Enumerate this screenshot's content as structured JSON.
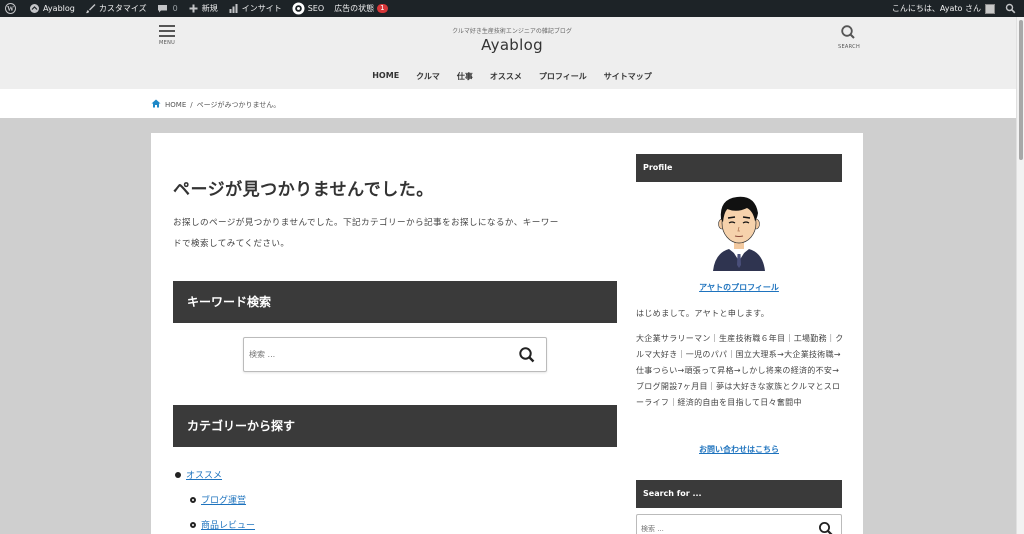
{
  "admin_bar": {
    "site_name": "Ayablog",
    "customize": "カスタマイズ",
    "comments_count": "0",
    "new": "新規",
    "insight": "インサイト",
    "seo": "SEO",
    "ad_status": "広告の状態",
    "ad_badge": "1",
    "greeting": "こんにちは、Ayato さん"
  },
  "header": {
    "menu_label": "MENU",
    "search_label": "SEARCH",
    "tagline": "クルマ好き生産技術エンジニアの雑記ブログ",
    "site_title": "Ayablog",
    "nav": [
      "HOME",
      "クルマ",
      "仕事",
      "オススメ",
      "プロフィール",
      "サイトマップ"
    ]
  },
  "breadcrumb": {
    "home": "HOME",
    "separator": "/",
    "current": "ページがみつかりません。"
  },
  "main": {
    "title": "ページが見つかりませんでした。",
    "intro_line1": "お探しのページが見つかりませんでした。下記カテゴリーから記事をお探しになるか、キーワー",
    "intro_line2": "ドで検索してみてください。",
    "keyword_heading": "キーワード検索",
    "search_placeholder": "検索 ...",
    "category_heading": "カテゴリーから探す",
    "categories": [
      {
        "label": "オススメ",
        "level": 0
      },
      {
        "label": "ブログ運営",
        "level": 1
      },
      {
        "label": "商品レビュー",
        "level": 1
      }
    ]
  },
  "sidebar": {
    "profile_heading": "Profile",
    "profile_link": "アヤトのプロフィール",
    "greeting": "はじめまして。アヤトと申します。",
    "bio": "大企業サラリーマン｜生産技術職６年目｜工場勤務｜クルマ大好き｜一児のパパ｜国立大理系→大企業技術職→仕事つらい→頑張って昇格→しかし将来の経済的不安→ブログ開設7ヶ月目｜夢は大好きな家族とクルマとスローライフ｜経済的自由を目指して日々奮闘中",
    "contact_link": "お問い合わせはこちら",
    "search_heading": "Search for ...",
    "search_placeholder": "検索 ..."
  },
  "colors": {
    "admin_bar_bg": "#1d2327",
    "header_bg": "#eeeeee",
    "section_head_bg": "#3a3a3a",
    "link": "#1e73be",
    "badge": "#d63638",
    "page_bg": "#cfcfcf"
  },
  "icons": [
    "wordpress-icon",
    "home-icon",
    "brush-icon",
    "comment-icon",
    "plus-icon",
    "bar-chart-icon",
    "seo-gear-icon",
    "search-icon",
    "hamburger-icon"
  ]
}
